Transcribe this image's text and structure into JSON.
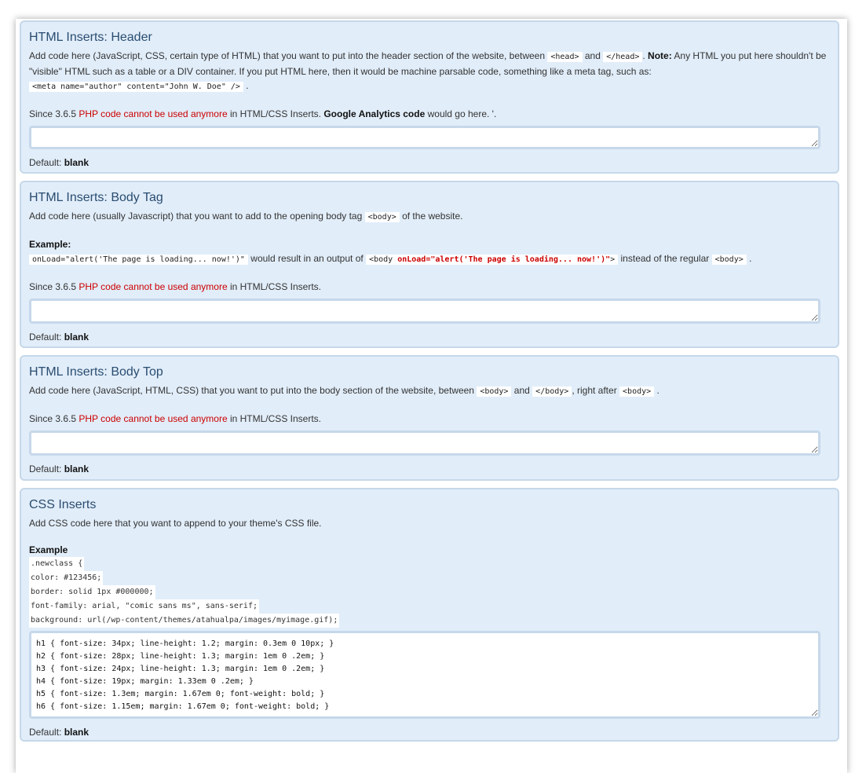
{
  "header_panel": {
    "title": "HTML Inserts: Header",
    "desc_pre": "Add code here (JavaScript, CSS, certain type of HTML) that you want to put into the header section of the website, between",
    "code_head_open": "<head>",
    "and": "and",
    "code_head_close": "</head>",
    "note_label": "Note:",
    "desc_post": "Any HTML you put here shouldn't be \"visible\" HTML such as a table or a DIV container. If you put HTML here, then it would be machine parsable code, something like a meta tag, such as:",
    "code_meta": "<meta name=\"author\" content=\"John W. Doe\" />",
    "since": "Since 3.6.5",
    "php_warning": "PHP code cannot be used anymore",
    "in_inserts": "in HTML/CSS Inserts.",
    "ga": "Google Analytics code",
    "ga_post": "would go here. '.",
    "textarea_value": "",
    "default_label": "Default:",
    "default_value": "blank"
  },
  "bodytag_panel": {
    "title": "HTML Inserts: Body Tag",
    "desc_pre": "Add code here (usually Javascript) that you want to add to the opening body tag",
    "code_body": "<body>",
    "desc_post": "of the website.",
    "example_label": "Example:",
    "code_onload": "onLoad=\"alert('The page is loading... now!')\"",
    "would_result": "would result in an output of",
    "code_body_open": "<body",
    "code_onload_red": "onLoad=\"alert('The page is loading... now!')\"",
    "code_gt": ">",
    "instead": "instead of the regular",
    "code_body_regular": "<body>",
    "period": ".",
    "since": "Since 3.6.5",
    "php_warning": "PHP code cannot be used anymore",
    "in_inserts": "in HTML/CSS Inserts.",
    "textarea_value": "",
    "default_label": "Default:",
    "default_value": "blank"
  },
  "bodytop_panel": {
    "title": "HTML Inserts: Body Top",
    "desc_pre": "Add code here (JavaScript, HTML, CSS) that you want to put into the body section of the website, between",
    "code_body": "<body>",
    "and": "and",
    "code_body_close": "</body>",
    "right_after": ", right after",
    "code_body2": "<body>",
    "period": ".",
    "since": "Since 3.6.5",
    "php_warning": "PHP code cannot be used anymore",
    "in_inserts": "in HTML/CSS Inserts.",
    "textarea_value": "",
    "default_label": "Default:",
    "default_value": "blank"
  },
  "css_panel": {
    "title": "CSS Inserts",
    "desc": "Add CSS code here that you want to append to your theme's CSS file.",
    "example_label": "Example",
    "example_lines": [
      ".newclass {",
      "color: #123456;",
      "border: solid 1px #000000;",
      "font-family: arial, \"comic sans ms\", sans-serif;",
      "background: url(/wp-content/themes/atahualpa/images/myimage.gif);"
    ],
    "textarea_value": "h1 { font-size: 34px; line-height: 1.2; margin: 0.3em 0 10px; }\nh2 { font-size: 28px; line-height: 1.3; margin: 1em 0 .2em; }\nh3 { font-size: 24px; line-height: 1.3; margin: 1em 0 .2em; }\nh4 { font-size: 19px; margin: 1.33em 0 .2em; }\nh5 { font-size: 1.3em; margin: 1.67em 0; font-weight: bold; }\nh6 { font-size: 1.15em; margin: 1.67em 0; font-weight: bold; }",
    "default_label": "Default:",
    "default_value": "blank"
  }
}
